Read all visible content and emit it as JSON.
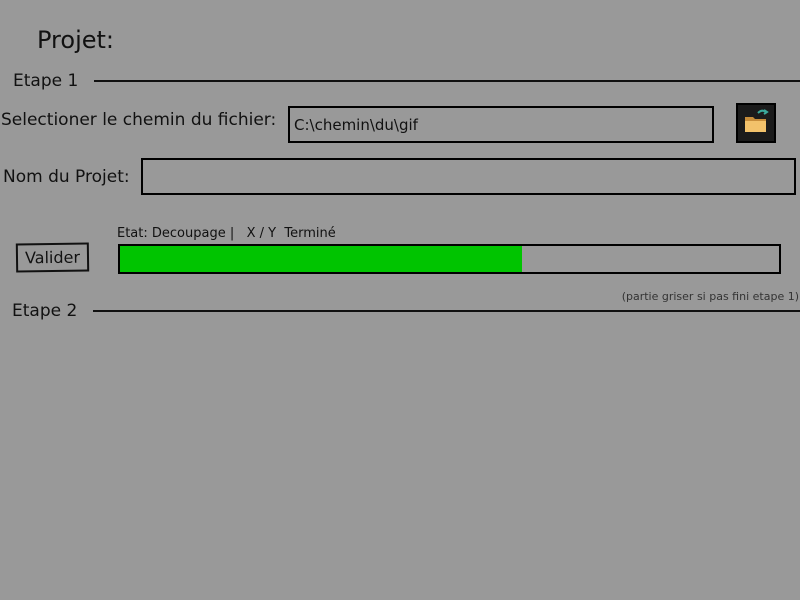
{
  "page": {
    "title": "Projet:"
  },
  "step1": {
    "label": "Etape 1",
    "file_path": {
      "label": "Selectioner le chemin du fichier:",
      "value": "C:\\chemin\\du\\gif"
    },
    "folder_button": {
      "icon": "folder-open-icon"
    },
    "project_name": {
      "label": "Nom du Projet:",
      "value": ""
    },
    "validate_label": "Valider",
    "status": {
      "text": "Etat: Decoupage |   X / Y  Terminé"
    },
    "progress": {
      "fraction": 0.61,
      "color": "#00c400"
    }
  },
  "step2": {
    "label": "Etape 2",
    "note": "(partie griser si pas fini etape 1)"
  },
  "colors": {
    "background": "#999999",
    "progress_fill": "#00c400",
    "folder_button_bg": "#1b1b1b"
  }
}
